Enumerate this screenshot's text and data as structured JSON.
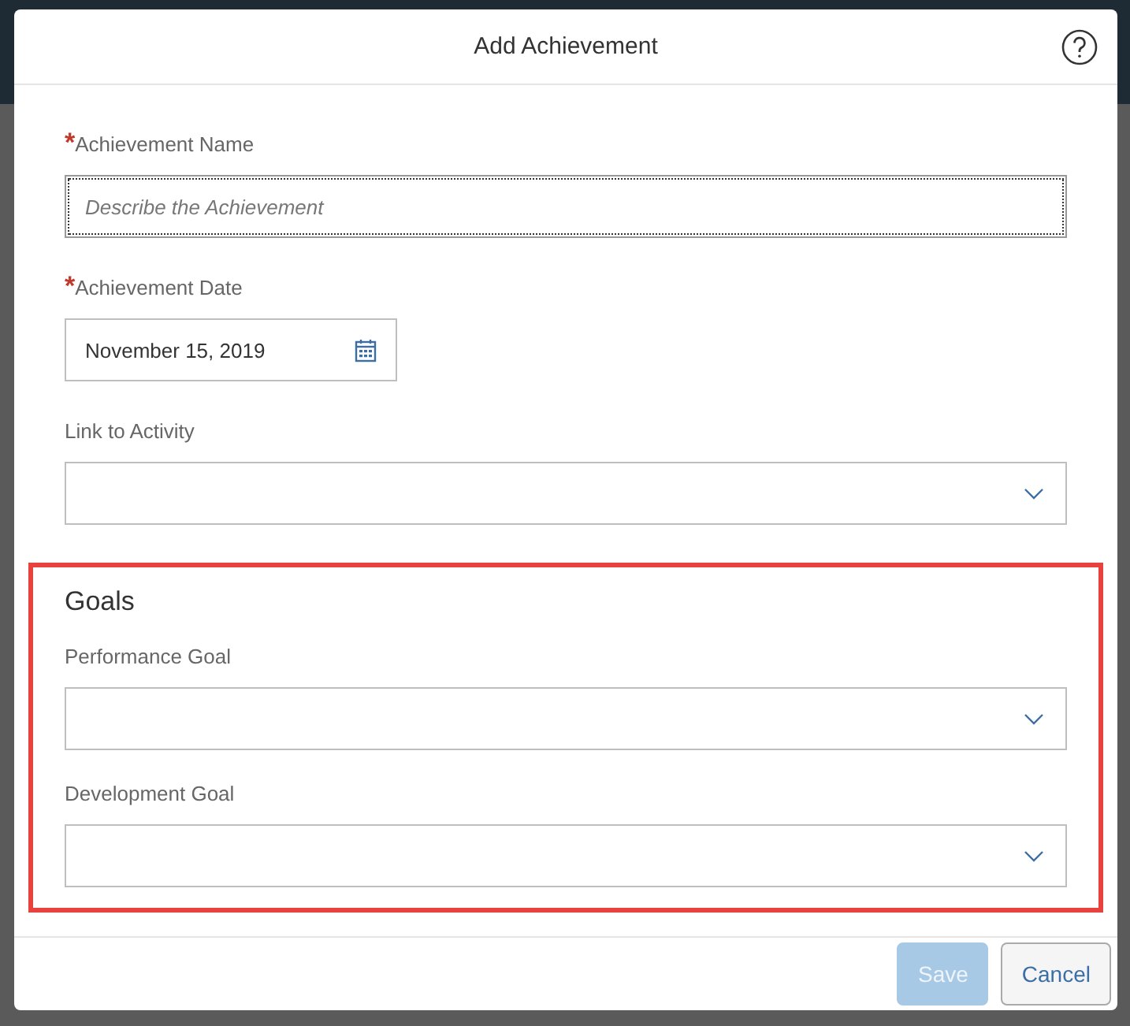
{
  "dialog": {
    "title": "Add Achievement",
    "fields": [
      {
        "kind": "text",
        "label": "Achievement Name",
        "required_mark": "*",
        "placeholder": "Describe the Achievement",
        "focused": true
      },
      {
        "kind": "date",
        "label": "Achievement Date",
        "required_mark": "*",
        "value": "November 15, 2019",
        "focused": false
      },
      {
        "kind": "select",
        "label": "Link to Activity",
        "focused": false
      }
    ],
    "goals": {
      "title": "Goals",
      "highlighted": true,
      "fields": [
        {
          "kind": "select",
          "label": "Performance Goal",
          "focused": false
        },
        {
          "kind": "select",
          "label": "Development Goal",
          "focused": false
        }
      ]
    },
    "buttons": [
      {
        "label": "Save",
        "kind": "primary",
        "disabled": true
      },
      {
        "label": "Cancel",
        "kind": "secondary",
        "disabled": false
      }
    ]
  }
}
